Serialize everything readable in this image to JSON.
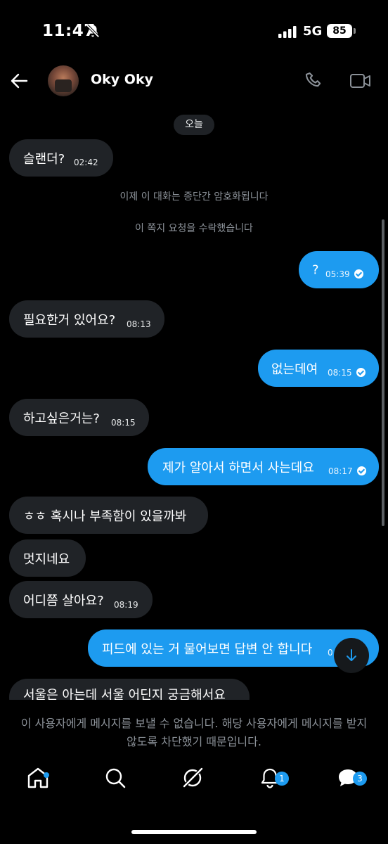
{
  "status": {
    "time": "11:47",
    "network": "5G",
    "battery": "85"
  },
  "header": {
    "name": "Oky Oky"
  },
  "date_pill": "오늘",
  "messages": [
    {
      "text": "슬랜더?",
      "time": "02:42"
    },
    {
      "text": "이제 이 대화는 종단간 암호화됩니다"
    },
    {
      "text": "이 쪽지 요청을 수락했습니다"
    },
    {
      "text": "?",
      "time": "05:39"
    },
    {
      "text": "필요한거 있어요?",
      "time": "08:13"
    },
    {
      "text": "없는데여",
      "time": "08:15"
    },
    {
      "text": "하고싶은거는?",
      "time": "08:15"
    },
    {
      "text": "제가 알아서 하면서 사는데요",
      "time": "08:17"
    },
    {
      "text": "ㅎㅎ 혹시나 부족함이 있을까봐"
    },
    {
      "text": "멋지네요"
    },
    {
      "text": "어디쯤 살아요?",
      "time": "08:19"
    },
    {
      "text": "피드에 있는 거 물어보면 답변 안 합니다",
      "time": "0"
    },
    {
      "text": "서울은 아는데 서울 어딘지 궁금해서요"
    }
  ],
  "blocked_notice": "이 사용자에게 메시지를 보낼 수 없습니다. 해당 사용자에게 메시지를 받지 않도록 차단했기 때문입니다.",
  "nav": {
    "notifications_badge": "1",
    "messages_badge": "3"
  },
  "colors": {
    "accent": "#1d9bf0",
    "incoming_bubble": "#202327",
    "background": "#000000"
  }
}
